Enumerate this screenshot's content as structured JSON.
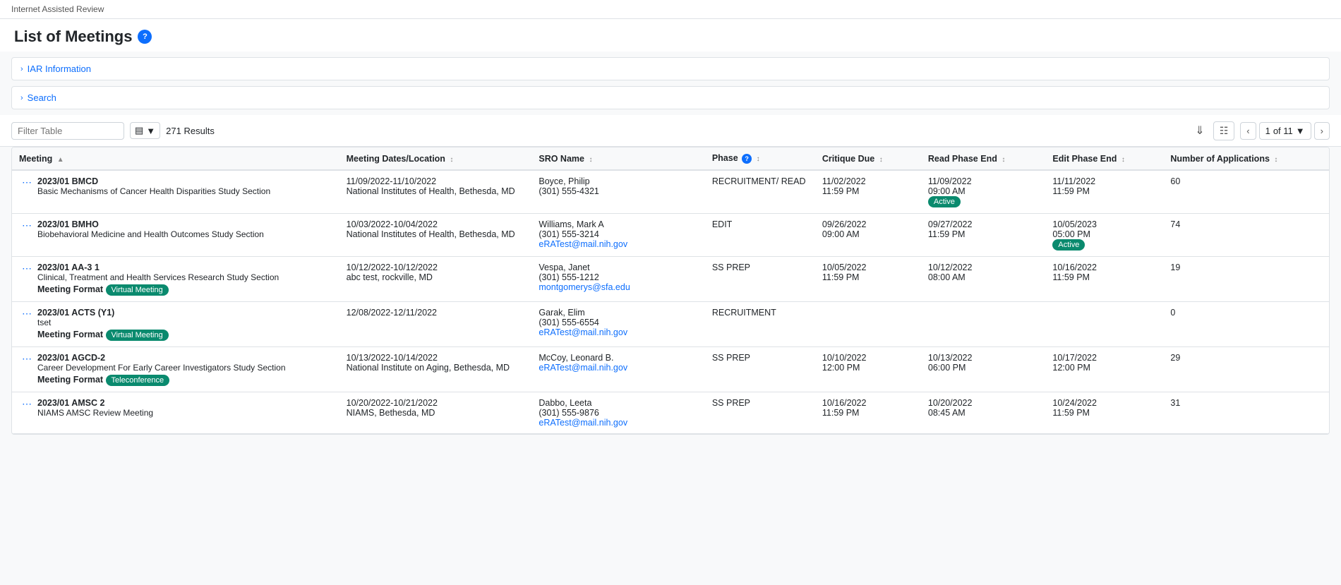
{
  "app": {
    "title": "Internet Assisted Review"
  },
  "page": {
    "title": "List of Meetings",
    "help_icon": "?"
  },
  "iar_section": {
    "label": "IAR Information"
  },
  "search_section": {
    "label": "Search"
  },
  "toolbar": {
    "filter_placeholder": "Filter Table",
    "results_count": "271 Results",
    "page_current": "1",
    "page_total": "of 11"
  },
  "columns": [
    {
      "id": "meeting",
      "label": "Meeting",
      "sort": "asc"
    },
    {
      "id": "dates",
      "label": "Meeting Dates/Location",
      "sort": "none"
    },
    {
      "id": "sro",
      "label": "SRO Name",
      "sort": "none"
    },
    {
      "id": "phase",
      "label": "Phase",
      "sort": "none",
      "help": true
    },
    {
      "id": "critique_due",
      "label": "Critique Due",
      "sort": "none"
    },
    {
      "id": "read_end",
      "label": "Read Phase End",
      "sort": "none"
    },
    {
      "id": "edit_end",
      "label": "Edit Phase End",
      "sort": "none"
    },
    {
      "id": "apps",
      "label": "Number of Applications",
      "sort": "none"
    }
  ],
  "rows": [
    {
      "id": "row1",
      "meeting_code": "2023/01 BMCD",
      "meeting_subtitle": "Basic Mechanisms of Cancer Health Disparities Study Section",
      "meeting_format": null,
      "meeting_format_label": null,
      "dates": "11/09/2022-11/10/2022",
      "location": "National Institutes of Health, Bethesda, MD",
      "sro_name": "Boyce, Philip",
      "sro_phone": "(301) 555-4321",
      "sro_email": null,
      "phase": "RECRUITMENT/ READ",
      "critique_due_date": "11/02/2022",
      "critique_due_time": "11:59 PM",
      "read_end_date": "11/09/2022",
      "read_end_time": "09:00 AM",
      "read_end_active": true,
      "edit_end_date": "11/11/2022",
      "edit_end_time": "11:59 PM",
      "edit_end_active": false,
      "applications": "60"
    },
    {
      "id": "row2",
      "meeting_code": "2023/01 BMHO",
      "meeting_subtitle": "Biobehavioral Medicine and Health Outcomes Study Section",
      "meeting_format": null,
      "meeting_format_label": null,
      "dates": "10/03/2022-10/04/2022",
      "location": "National Institutes of Health, Bethesda, MD",
      "sro_name": "Williams, Mark A",
      "sro_phone": "(301) 555-3214",
      "sro_email": "eRATest@mail.nih.gov",
      "phase": "EDIT",
      "critique_due_date": "09/26/2022",
      "critique_due_time": "09:00 AM",
      "read_end_date": "09/27/2022",
      "read_end_time": "11:59 PM",
      "read_end_active": false,
      "edit_end_date": "10/05/2023",
      "edit_end_time": "05:00 PM",
      "edit_end_active": true,
      "applications": "74"
    },
    {
      "id": "row3",
      "meeting_code": "2023/01 AA-3 1",
      "meeting_subtitle": "Clinical, Treatment and Health Services Research Study Section",
      "meeting_format": "Virtual Meeting",
      "meeting_format_label": "Virtual Meeting",
      "dates": "10/12/2022-10/12/2022",
      "location": "abc test, rockville, MD",
      "sro_name": "Vespa, Janet",
      "sro_phone": "(301) 555-1212",
      "sro_email": "montgomerys@sfa.edu",
      "phase": "SS PREP",
      "critique_due_date": "10/05/2022",
      "critique_due_time": "11:59 PM",
      "read_end_date": "10/12/2022",
      "read_end_time": "08:00 AM",
      "read_end_active": false,
      "edit_end_date": "10/16/2022",
      "edit_end_time": "11:59 PM",
      "edit_end_active": false,
      "applications": "19"
    },
    {
      "id": "row4",
      "meeting_code": "2023/01 ACTS (Y1)",
      "meeting_subtitle": "tset",
      "meeting_format": "Virtual Meeting",
      "meeting_format_label": "Virtual Meeting",
      "dates": "12/08/2022-12/11/2022",
      "location": null,
      "sro_name": "Garak, Elim",
      "sro_phone": "(301) 555-6554",
      "sro_email": "eRATest@mail.nih.gov",
      "phase": "RECRUITMENT",
      "critique_due_date": null,
      "critique_due_time": null,
      "read_end_date": null,
      "read_end_time": null,
      "read_end_active": false,
      "edit_end_date": null,
      "edit_end_time": null,
      "edit_end_active": false,
      "applications": "0"
    },
    {
      "id": "row5",
      "meeting_code": "2023/01 AGCD-2",
      "meeting_subtitle": "Career Development For Early Career Investigators Study Section",
      "meeting_format": "Teleconference",
      "meeting_format_label": "Teleconference",
      "dates": "10/13/2022-10/14/2022",
      "location": "National Institute on Aging, Bethesda, MD",
      "sro_name": "McCoy, Leonard B.",
      "sro_phone": null,
      "sro_email": "eRATest@mail.nih.gov",
      "phase": "SS PREP",
      "critique_due_date": "10/10/2022",
      "critique_due_time": "12:00 PM",
      "read_end_date": "10/13/2022",
      "read_end_time": "06:00 PM",
      "read_end_active": false,
      "edit_end_date": "10/17/2022",
      "edit_end_time": "12:00 PM",
      "edit_end_active": false,
      "applications": "29"
    },
    {
      "id": "row6",
      "meeting_code": "2023/01 AMSC 2",
      "meeting_subtitle": "NIAMS AMSC Review Meeting",
      "meeting_format": null,
      "meeting_format_label": null,
      "dates": "10/20/2022-10/21/2022",
      "location": "NIAMS, Bethesda, MD",
      "sro_name": "Dabbo, Leeta",
      "sro_phone": "(301) 555-9876",
      "sro_email": "eRATest@mail.nih.gov",
      "phase": "SS PREP",
      "critique_due_date": "10/16/2022",
      "critique_due_time": "11:59 PM",
      "read_end_date": "10/20/2022",
      "read_end_time": "08:45 AM",
      "read_end_active": false,
      "edit_end_date": "10/24/2022",
      "edit_end_time": "11:59 PM",
      "edit_end_active": false,
      "applications": "31"
    }
  ]
}
